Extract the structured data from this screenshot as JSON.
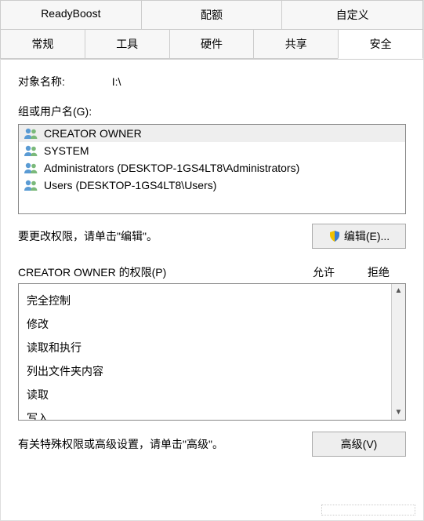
{
  "tabs": {
    "row1": [
      {
        "label": "ReadyBoost"
      },
      {
        "label": "配额"
      },
      {
        "label": "自定义"
      }
    ],
    "row2": [
      {
        "label": "常规"
      },
      {
        "label": "工具"
      },
      {
        "label": "硬件"
      },
      {
        "label": "共享"
      },
      {
        "label": "安全",
        "active": true
      }
    ]
  },
  "object_name": {
    "label": "对象名称:",
    "value": "I:\\"
  },
  "groups": {
    "label": "组或用户名(G):",
    "items": [
      {
        "label": "CREATOR OWNER",
        "selected": true
      },
      {
        "label": "SYSTEM"
      },
      {
        "label": "Administrators (DESKTOP-1GS4LT8\\Administrators)"
      },
      {
        "label": "Users (DESKTOP-1GS4LT8\\Users)"
      }
    ]
  },
  "edit": {
    "hint": "要更改权限，请单击\"编辑\"。",
    "button": "编辑(E)..."
  },
  "permissions": {
    "title": "CREATOR OWNER 的权限(P)",
    "allow": "允许",
    "deny": "拒绝",
    "items": [
      {
        "label": "完全控制"
      },
      {
        "label": "修改"
      },
      {
        "label": "读取和执行"
      },
      {
        "label": "列出文件夹内容"
      },
      {
        "label": "读取"
      },
      {
        "label": "写入"
      }
    ]
  },
  "advanced": {
    "hint": "有关特殊权限或高级设置，请单击\"高级\"。",
    "button": "高级(V)"
  }
}
